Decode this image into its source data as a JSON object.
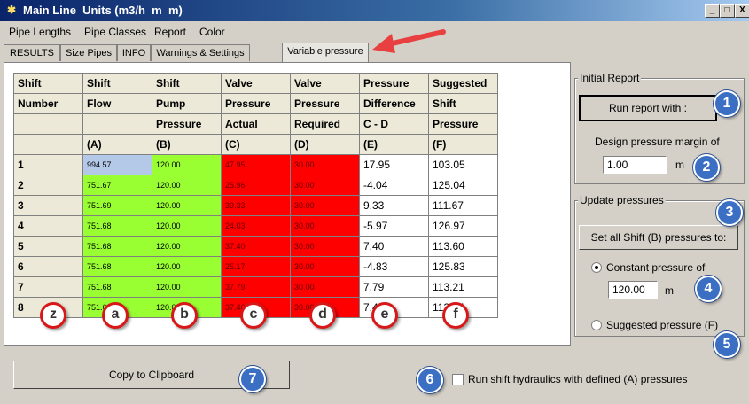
{
  "window": {
    "title": "Main Line  Units (m3/h  m  m)",
    "minimize": "_",
    "maximize": "□",
    "close": "X"
  },
  "menu": [
    "Pipe Lengths",
    "Pipe Classes",
    "Report",
    "Color"
  ],
  "tabs": [
    "RESULTS",
    "Size Pipes",
    "INFO",
    "Warnings & Settings",
    "Variable pressure"
  ],
  "active_tab": "Variable pressure",
  "table": {
    "header_rows": [
      [
        "Shift",
        "Shift",
        "Shift",
        "Valve",
        "Valve",
        "Pressure",
        "Suggested"
      ],
      [
        "Number",
        "Flow",
        "Pump",
        "Pressure",
        "Pressure",
        "Difference",
        "Shift"
      ],
      [
        "",
        "",
        "Pressure",
        "Actual",
        "Required",
        "C - D",
        "Pressure"
      ],
      [
        "",
        "(A)",
        "(B)",
        "(C)",
        "(D)",
        "(E)",
        "(F)"
      ]
    ],
    "rows": [
      [
        "1",
        "994.57",
        "120.00",
        "47.95",
        "30.00",
        "17.95",
        "103.05"
      ],
      [
        "2",
        "751.67",
        "120.00",
        "25.96",
        "30.00",
        "-4.04",
        "125.04"
      ],
      [
        "3",
        "751.69",
        "120.00",
        "39.33",
        "30.00",
        "9.33",
        "111.67"
      ],
      [
        "4",
        "751.68",
        "120.00",
        "24.03",
        "30.00",
        "-5.97",
        "126.97"
      ],
      [
        "5",
        "751.68",
        "120.00",
        "37.40",
        "30.00",
        "7.40",
        "113.60"
      ],
      [
        "6",
        "751.68",
        "120.00",
        "25.17",
        "30.00",
        "-4.83",
        "125.83"
      ],
      [
        "7",
        "751.68",
        "120.00",
        "37.79",
        "30.00",
        "7.79",
        "113.21"
      ],
      [
        "8",
        "751.68",
        "120.00",
        "37.46",
        "30.00",
        "7.46",
        "113.54"
      ]
    ]
  },
  "initial_report": {
    "group_label": "Initial Report",
    "run_button": "Run report with :",
    "margin_label": "Design pressure margin of",
    "margin_value": "1.00",
    "margin_unit": "m"
  },
  "update_pressures": {
    "group_label": "Update pressures",
    "set_all_button": "Set all Shift (B) pressures to:",
    "constant_label": "Constant pressure of",
    "constant_value": "120.00",
    "constant_unit": "m",
    "suggested_label": "Suggested pressure (F)",
    "selected": "constant"
  },
  "copy_button": "Copy to Clipboard",
  "run_hydraulics_label": "Run shift hydraulics with defined (A) pressures",
  "callouts_numbers": [
    "1",
    "2",
    "3",
    "4",
    "5",
    "6",
    "7"
  ],
  "callouts_letters": [
    "z",
    "a",
    "b",
    "c",
    "d",
    "e",
    "f"
  ],
  "colors": {
    "flow_selected": "#b4c8e8",
    "green": "#99ff33",
    "red": "#ff0000",
    "arrow": "#e84040"
  }
}
